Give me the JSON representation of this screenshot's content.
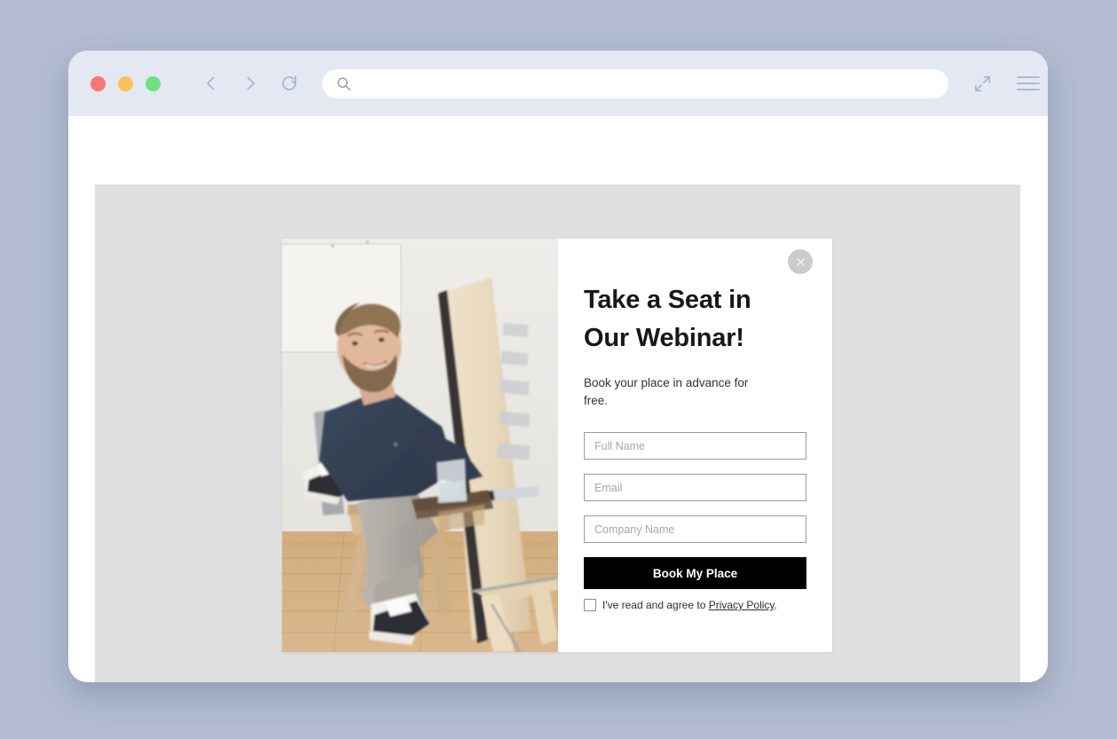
{
  "browser": {
    "traffic_lights": [
      {
        "name": "close",
        "color": "#fa7676"
      },
      {
        "name": "minimize",
        "color": "#fbc05a"
      },
      {
        "name": "maximize",
        "color": "#6ee07f"
      }
    ],
    "nav": {
      "back_icon": "chevron-left-icon",
      "forward_icon": "chevron-right-icon",
      "reload_icon": "reload-icon"
    },
    "address": {
      "icon": "search-icon",
      "value": "",
      "placeholder": ""
    },
    "right_icons": [
      {
        "name": "expand-icon"
      },
      {
        "name": "hamburger-menu-icon"
      }
    ]
  },
  "modal": {
    "close_label": "×",
    "close_icon": "close-icon",
    "title": "Take a Seat in Our Webinar!",
    "subtitle": "Book your place in advance for free.",
    "fields": [
      {
        "name": "full-name",
        "placeholder": "Full Name",
        "value": ""
      },
      {
        "name": "email",
        "placeholder": "Email",
        "value": ""
      },
      {
        "name": "company-name",
        "placeholder": "Company Name",
        "value": ""
      }
    ],
    "submit_label": "Book My Place",
    "consent": {
      "checked": false,
      "text_before": "I've read and agree to ",
      "link_label": "Privacy Policy",
      "text_after": "."
    },
    "photo": {
      "alt": "Man with beard in navy sweater seated on wooden chair beside a plywood easel whiteboard in a bright room"
    }
  },
  "colors": {
    "desktop_background": "#b3bcd0",
    "toolbar": "#e3e8f3",
    "page_background": "#e0e0e1",
    "modal_background": "#ffffff",
    "accent_button": "#000000",
    "close_button": "#cbcbcb"
  }
}
